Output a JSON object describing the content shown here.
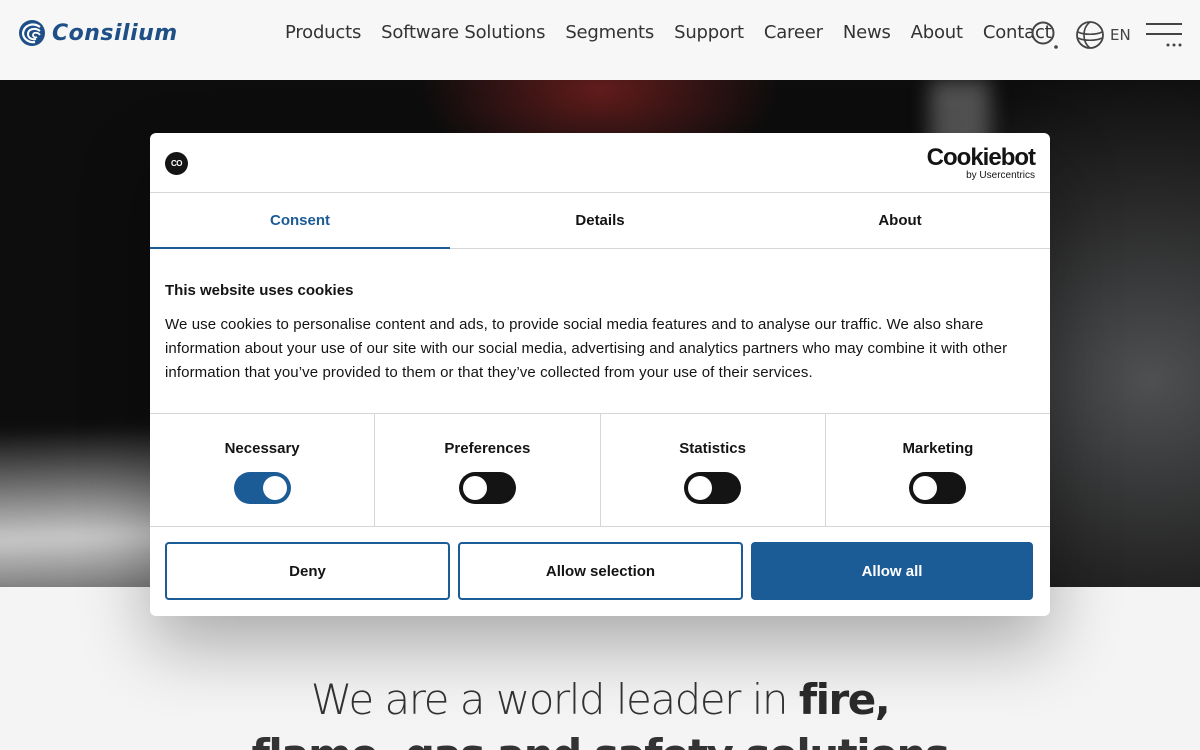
{
  "header": {
    "logo_text": "Consilium",
    "nav": [
      "Products",
      "Software Solutions",
      "Segments",
      "Support",
      "Career",
      "News",
      "About",
      "Contact"
    ],
    "language": "EN",
    "icons": {
      "search": "search-icon",
      "language": "globe-icon",
      "menu": "hamburger-menu-icon"
    },
    "brand_color": "#1e4f86"
  },
  "cookie_dialog": {
    "logo_text": "CO",
    "brand_name": "Cookiebot",
    "brand_sub": "by Usercentrics",
    "tabs": [
      {
        "label": "Consent",
        "active": true
      },
      {
        "label": "Details",
        "active": false
      },
      {
        "label": "About",
        "active": false
      }
    ],
    "title": "This website uses cookies",
    "body": "We use cookies to personalise content and ads, to provide social media features and to analyse our traffic. We also share information about your use of our site with our social media, advertising and analytics partners who may combine it with other information that you’ve provided to them or that they’ve collected from your use of their services.",
    "categories": [
      {
        "label": "Necessary",
        "enabled": true
      },
      {
        "label": "Preferences",
        "enabled": false
      },
      {
        "label": "Statistics",
        "enabled": false
      },
      {
        "label": "Marketing",
        "enabled": false
      }
    ],
    "buttons": {
      "deny": "Deny",
      "allow_selection": "Allow selection",
      "allow_all": "Allow all"
    },
    "accent_color": "#1b5b96"
  },
  "hero_tagline": {
    "line1_light": "We are a world leader in ",
    "line1_bold": "fire,",
    "line2": "flame, gas and safety solutions"
  }
}
